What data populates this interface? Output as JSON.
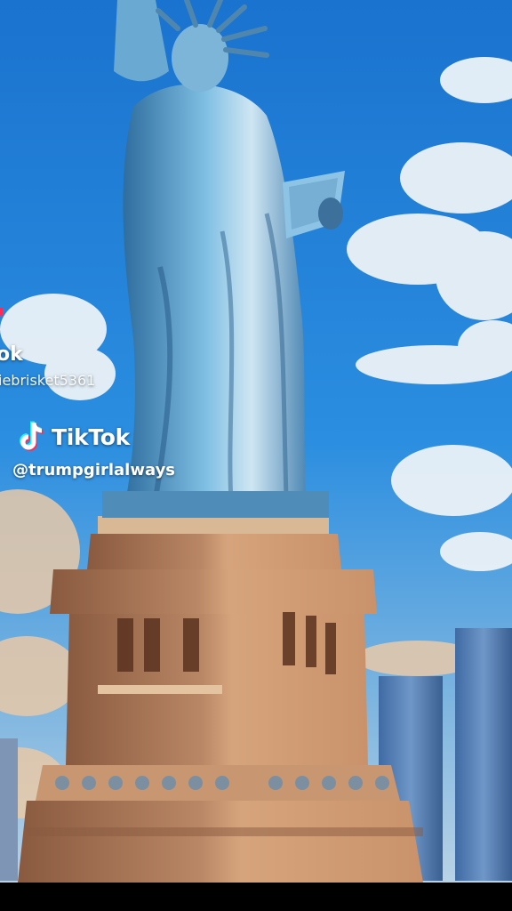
{
  "video": {
    "scene_description": "Illustrated Statue of Liberty against a blue sky with clouds and city skyline",
    "colors": {
      "sky": "#1f7fd6",
      "statue": "#5f9fc6",
      "pedestal": "#c08a63",
      "bar": "#000000"
    }
  },
  "watermark_previous": {
    "brand_fragment": "ok",
    "handle_fragment": "iebrisket5361"
  },
  "watermark": {
    "logo_icon": "tiktok-note-icon",
    "brand": "TikTok",
    "handle": "@trumpgirlalways"
  }
}
